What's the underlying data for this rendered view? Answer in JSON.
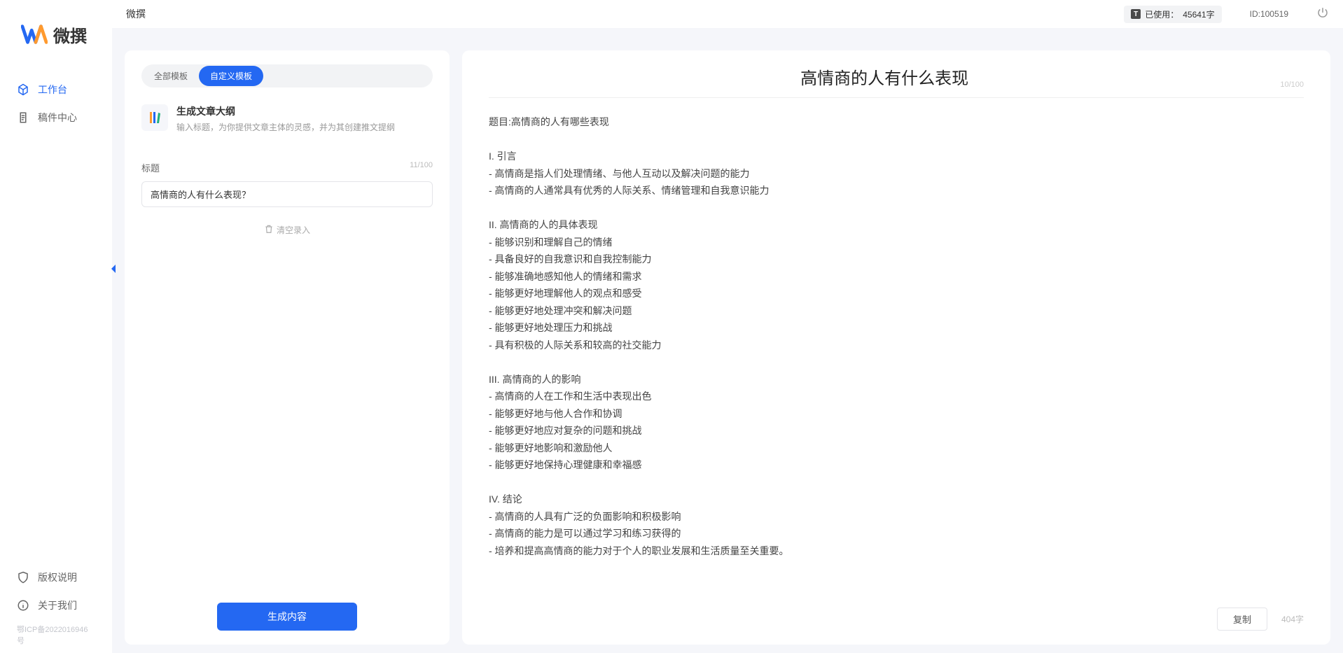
{
  "brand": {
    "name": "微撰"
  },
  "header": {
    "title": "微撰",
    "usage_prefix": "已使用：",
    "usage_value": "45641字",
    "id_label": "ID:100519"
  },
  "sidebar": {
    "nav": [
      {
        "key": "workspace",
        "label": "工作台",
        "active": true
      },
      {
        "key": "drafts",
        "label": "稿件中心",
        "active": false
      }
    ],
    "bottom": [
      {
        "key": "copyright",
        "label": "版权说明"
      },
      {
        "key": "about",
        "label": "关于我们"
      }
    ],
    "icp": "鄂ICP备2022016946号"
  },
  "leftPanel": {
    "tabs": [
      {
        "key": "all",
        "label": "全部模板",
        "active": false
      },
      {
        "key": "custom",
        "label": "自定义模板",
        "active": true
      }
    ],
    "template": {
      "name": "生成文章大纲",
      "desc": "输入标题，为你提供文章主体的灵感，并为其创建推文提纲"
    },
    "field": {
      "label": "标题",
      "counter": "11/100",
      "value": "高情商的人有什么表现？"
    },
    "clear_label": "清空录入",
    "generate_label": "生成内容"
  },
  "output": {
    "title": "高情商的人有什么表现",
    "title_counter": "10/100",
    "body": "题目:高情商的人有哪些表现\n\nI. 引言\n- 高情商是指人们处理情绪、与他人互动以及解决问题的能力\n- 高情商的人通常具有优秀的人际关系、情绪管理和自我意识能力\n\nII. 高情商的人的具体表现\n- 能够识别和理解自己的情绪\n- 具备良好的自我意识和自我控制能力\n- 能够准确地感知他人的情绪和需求\n- 能够更好地理解他人的观点和感受\n- 能够更好地处理冲突和解决问题\n- 能够更好地处理压力和挑战\n- 具有积极的人际关系和较高的社交能力\n\nIII. 高情商的人的影响\n- 高情商的人在工作和生活中表现出色\n- 能够更好地与他人合作和协调\n- 能够更好地应对复杂的问题和挑战\n- 能够更好地影响和激励他人\n- 能够更好地保持心理健康和幸福感\n\nIV. 结论\n- 高情商的人具有广泛的负面影响和积极影响\n- 高情商的能力是可以通过学习和练习获得的\n- 培养和提高高情商的能力对于个人的职业发展和生活质量至关重要。",
    "copy_label": "复制",
    "word_count_label": "404字"
  }
}
